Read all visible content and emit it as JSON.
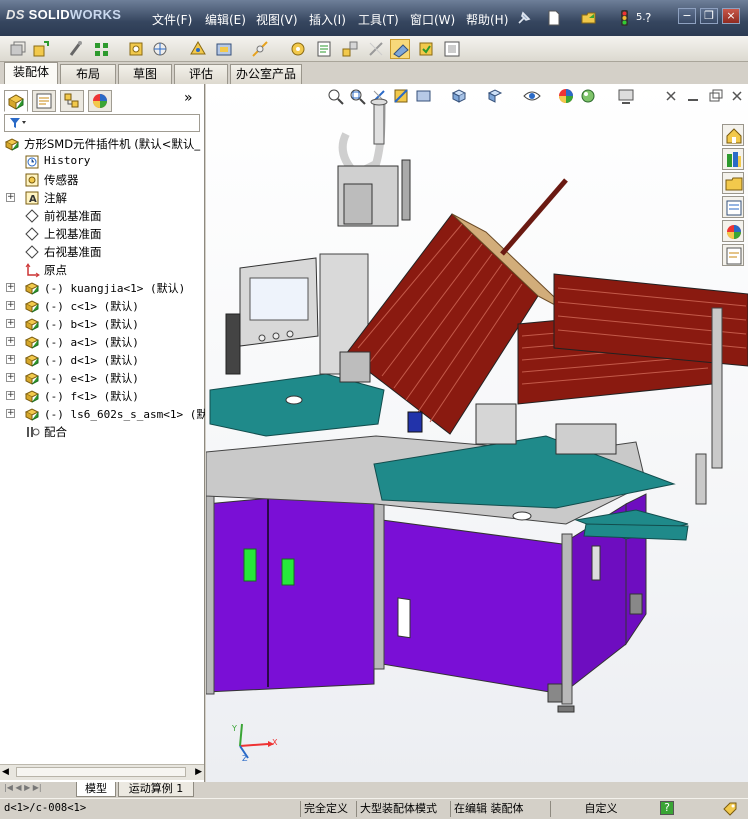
{
  "app": {
    "brand_ds": "DS",
    "brand_solid": "SOLID",
    "brand_works": "WORKS"
  },
  "menu": {
    "items": [
      "文件(F)",
      "编辑(E)",
      "视图(V)",
      "插入(I)",
      "工具(T)",
      "窗口(W)",
      "帮助(H)"
    ]
  },
  "title_right": {
    "help_label": "?",
    "search_label": "5."
  },
  "command_tabs": [
    "装配体",
    "布局",
    "草图",
    "评估",
    "办公室产品"
  ],
  "panel": {
    "collapse_label": "»",
    "filter_icon": "filter-icon",
    "tree": [
      {
        "label": "方形SMD元件插件机  (默认<默认_",
        "icon": "assembly-icon",
        "indent": 0,
        "expandable": false
      },
      {
        "label": "History",
        "icon": "history-icon",
        "indent": 1,
        "expandable": false
      },
      {
        "label": "传感器",
        "icon": "sensor-icon",
        "indent": 1,
        "expandable": false
      },
      {
        "label": "注解",
        "icon": "annotation-icon",
        "indent": 1,
        "expandable": true
      },
      {
        "label": "前视基准面",
        "icon": "plane-icon",
        "indent": 1,
        "expandable": false
      },
      {
        "label": "上视基准面",
        "icon": "plane-icon",
        "indent": 1,
        "expandable": false
      },
      {
        "label": "右视基准面",
        "icon": "plane-icon",
        "indent": 1,
        "expandable": false
      },
      {
        "label": "原点",
        "icon": "origin-icon",
        "indent": 1,
        "expandable": false
      },
      {
        "label": "(-) kuangjia<1> (默认)",
        "icon": "subassembly-icon",
        "indent": 1,
        "expandable": true
      },
      {
        "label": "(-) c<1> (默认)",
        "icon": "subassembly-icon",
        "indent": 1,
        "expandable": true
      },
      {
        "label": "(-) b<1> (默认)",
        "icon": "subassembly-icon",
        "indent": 1,
        "expandable": true
      },
      {
        "label": "(-) a<1> (默认)",
        "icon": "subassembly-icon",
        "indent": 1,
        "expandable": true
      },
      {
        "label": "(-) d<1> (默认)",
        "icon": "subassembly-icon",
        "indent": 1,
        "expandable": true
      },
      {
        "label": "(-) e<1> (默认)",
        "icon": "subassembly-icon",
        "indent": 1,
        "expandable": true
      },
      {
        "label": "(-) f<1> (默认)",
        "icon": "subassembly-icon",
        "indent": 1,
        "expandable": true
      },
      {
        "label": "(-) ls6_602s_s_asm<1> (默认",
        "icon": "subassembly-icon",
        "indent": 1,
        "expandable": true
      },
      {
        "label": "配合",
        "icon": "mates-icon",
        "indent": 1,
        "expandable": false
      }
    ]
  },
  "bottom_tabs": [
    "模型",
    "运动算例 1"
  ],
  "status": {
    "selection": "d<1>/c-008<1>",
    "fully_defined": "完全定义",
    "large_assembly": "大型装配体模式",
    "editing": "在编辑 装配体",
    "custom": "自定义",
    "help": "?"
  },
  "triad": {
    "x": "X",
    "y": "Y",
    "z": "Z"
  },
  "colors": {
    "title_bar": "#36465f",
    "machine_purple": "#7a0fd6",
    "machine_teal": "#1f8a8a",
    "frame_gray": "#b8b8b8",
    "tray_red": "#8a1a10",
    "window_green": "#27e83b"
  }
}
